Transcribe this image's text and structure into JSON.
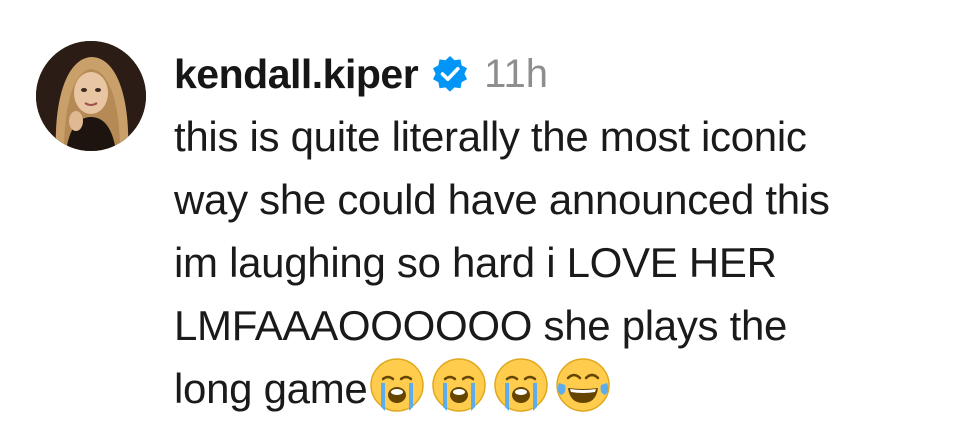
{
  "comment": {
    "username": "kendall.kiper",
    "verified_icon": "verified-badge-icon",
    "timestamp": "11h",
    "lines": [
      "this is quite literally the most iconic",
      "way she could have announced this",
      "im laughing so hard i LOVE HER",
      "LMFAAAOOOOOO she plays the",
      "long game"
    ],
    "emojis": [
      "loudly-crying-face",
      "loudly-crying-face",
      "loudly-crying-face",
      "face-with-tears-of-joy"
    ]
  },
  "colors": {
    "verified_blue": "#0095f6",
    "timestamp_gray": "#8e8e8e",
    "text": "#1a1a1a"
  }
}
